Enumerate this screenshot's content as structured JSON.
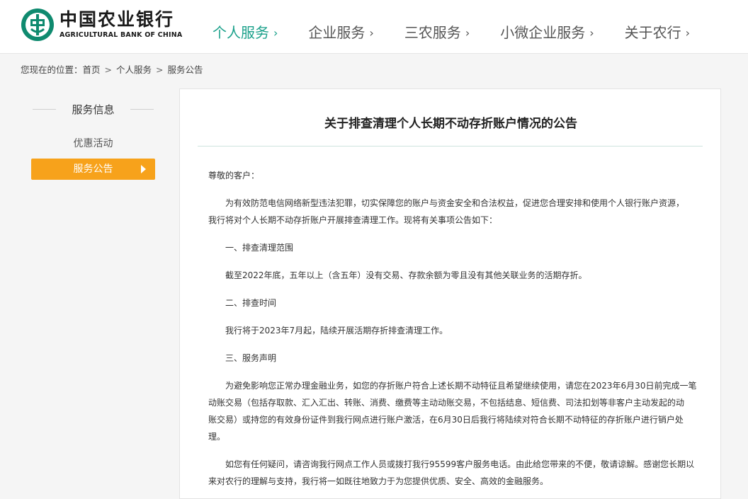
{
  "header": {
    "logo_cn": "中国农业银行",
    "logo_en": "AGRICULTURAL BANK OF CHINA",
    "nav": [
      {
        "label": "个人服务",
        "active": true
      },
      {
        "label": "企业服务",
        "active": false
      },
      {
        "label": "三农服务",
        "active": false
      },
      {
        "label": "小微企业服务",
        "active": false
      },
      {
        "label": "关于农行",
        "active": false
      }
    ],
    "chevron": "›"
  },
  "breadcrumb": {
    "prefix": "您现在的位置：",
    "items": [
      "首页",
      "个人服务",
      "服务公告"
    ],
    "separator": ">"
  },
  "sidebar": {
    "title": "服务信息",
    "items": [
      {
        "label": "优惠活动",
        "active": false
      },
      {
        "label": "服务公告",
        "active": true
      }
    ]
  },
  "article": {
    "title": "关于排查清理个人长期不动存折账户情况的公告",
    "greeting": "尊敬的客户：",
    "intro_1": "为有效防范电信网络新型违法犯罪，切实保障您的账户与资金安全和合法权益，促进您合理安排和使用个人银行账户资源，",
    "intro_2": "我行将对个人长期不动存折账户开展排查清理工作。现将有关事项公告如下：",
    "h1": "一、排查清理范围",
    "p1": "截至2022年底，五年以上（含五年）没有交易、存款余额为零且没有其他关联业务的活期存折。",
    "h2": "二、排查时间",
    "p2": "我行将于2023年7月起，陆续开展活期存折排查清理工作。",
    "h3": "三、服务声明",
    "p3_1": "为避免影响您正常办理金融业务，如您的存折账户符合上述长期不动特征且希望继续使用，请您在2023年6月30日前完成一笔",
    "p3_2": "动账交易（包括存取款、汇入汇出、转账、消费、缴费等主动动账交易，不包括结息、短信费、司法扣划等非客户主动发起的动",
    "p3_3": "账交易）或持您的有效身份证件到我行网点进行账户激活，在6月30日后我行将陆续对符合长期不动特征的存折账户进行销户处",
    "p3_4": "理。",
    "p4_1": "如您有任何疑问，请咨询我行网点工作人员或拨打我行95599客户服务电话。由此给您带来的不便，敬请谅解。感谢您长期以",
    "p4_2": "来对农行的理解与支持，我行将一如既往地致力于为您提供优质、安全、高效的金融服务。"
  },
  "colors": {
    "brand_green": "#0f8a6f",
    "nav_active": "#1aa08a",
    "sidebar_active": "#f7a21b"
  }
}
